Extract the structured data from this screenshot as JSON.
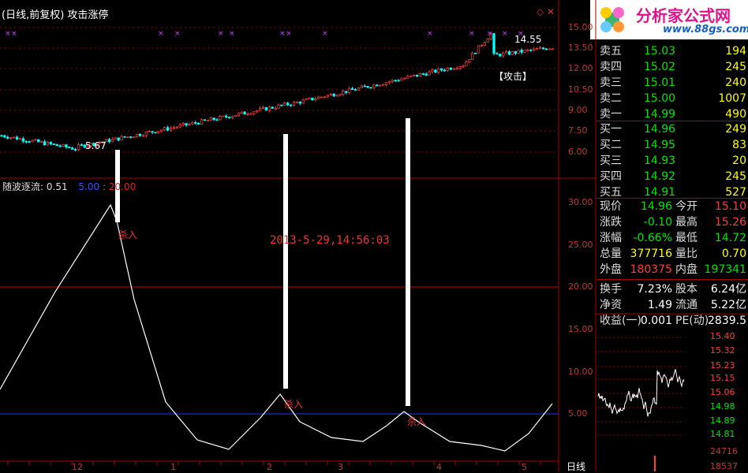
{
  "header": {
    "title": "(日线,前复权) 攻击涨停"
  },
  "logo": {
    "name": "分析家公式网",
    "url": "www.88gs.com"
  },
  "main_chart": {
    "high_label": "14.55",
    "low_label": "5.67",
    "signal_tag": "【攻击】",
    "price_axis": [
      "15.00",
      "13.50",
      "12.00",
      "10.50",
      "9.00",
      "7.50",
      "6.00"
    ]
  },
  "indicator": {
    "name": "随波逐流:",
    "value": "0.51",
    "level_low": "5.00",
    "level_high": "20.00",
    "buy_label": "杀入",
    "timestamp": "2013-5-29,14:56:03",
    "axis": [
      "30.00",
      "25.00",
      "20.00",
      "15.00",
      "10.00",
      "5.00"
    ]
  },
  "x_axis": {
    "labels": [
      "12",
      "1",
      "2",
      "3",
      "4",
      "5"
    ],
    "period_button": "日线"
  },
  "order_book": {
    "sell": [
      {
        "label": "卖五",
        "price": "15.03",
        "volume": "194"
      },
      {
        "label": "卖四",
        "price": "15.02",
        "volume": "245"
      },
      {
        "label": "卖三",
        "price": "15.01",
        "volume": "240"
      },
      {
        "label": "卖二",
        "price": "15.00",
        "volume": "1007"
      },
      {
        "label": "卖一",
        "price": "14.99",
        "volume": "490"
      }
    ],
    "buy": [
      {
        "label": "买一",
        "price": "14.96",
        "volume": "249"
      },
      {
        "label": "买二",
        "price": "14.95",
        "volume": "83"
      },
      {
        "label": "买三",
        "price": "14.93",
        "volume": "20"
      },
      {
        "label": "买四",
        "price": "14.92",
        "volume": "245"
      },
      {
        "label": "买五",
        "price": "14.91",
        "volume": "527"
      }
    ]
  },
  "quote": {
    "rows": [
      {
        "l1": "现价",
        "v1": "14.96",
        "l2": "今开",
        "v2": "15.10"
      },
      {
        "l1": "涨跌",
        "v1": "-0.10",
        "l2": "最高",
        "v2": "15.26"
      },
      {
        "l1": "涨幅",
        "v1": "-0.66%",
        "l2": "最低",
        "v2": "14.72"
      },
      {
        "l1": "总量",
        "v1": "377716",
        "l2": "量比",
        "v2": "0.70"
      },
      {
        "l1": "外盘",
        "v1": "180375",
        "l2": "内盘",
        "v2": "197341"
      },
      {
        "l1": "换手",
        "v1": "7.23%",
        "l2": "股本",
        "v2": "6.24亿"
      },
      {
        "l1": "净资",
        "v1": "1.49",
        "l2": "流通",
        "v2": "5.22亿"
      },
      {
        "l1": "收益(一)",
        "v1": "0.001",
        "l2": "PE(动)",
        "v2": "2839.5"
      }
    ]
  },
  "minute_chart": {
    "axis": [
      "15.40",
      "15.32",
      "15.23",
      "15.15",
      "15.06",
      "14.98",
      "14.89",
      "14.81"
    ],
    "volume_labels": [
      "24716",
      "18537"
    ]
  },
  "colors": {
    "up": "#ff3c3c",
    "down": "#00ffff",
    "grid": "#8b0000",
    "axis_text": "#c0392b",
    "green": "#00e600",
    "yellow": "#ffff00"
  }
}
